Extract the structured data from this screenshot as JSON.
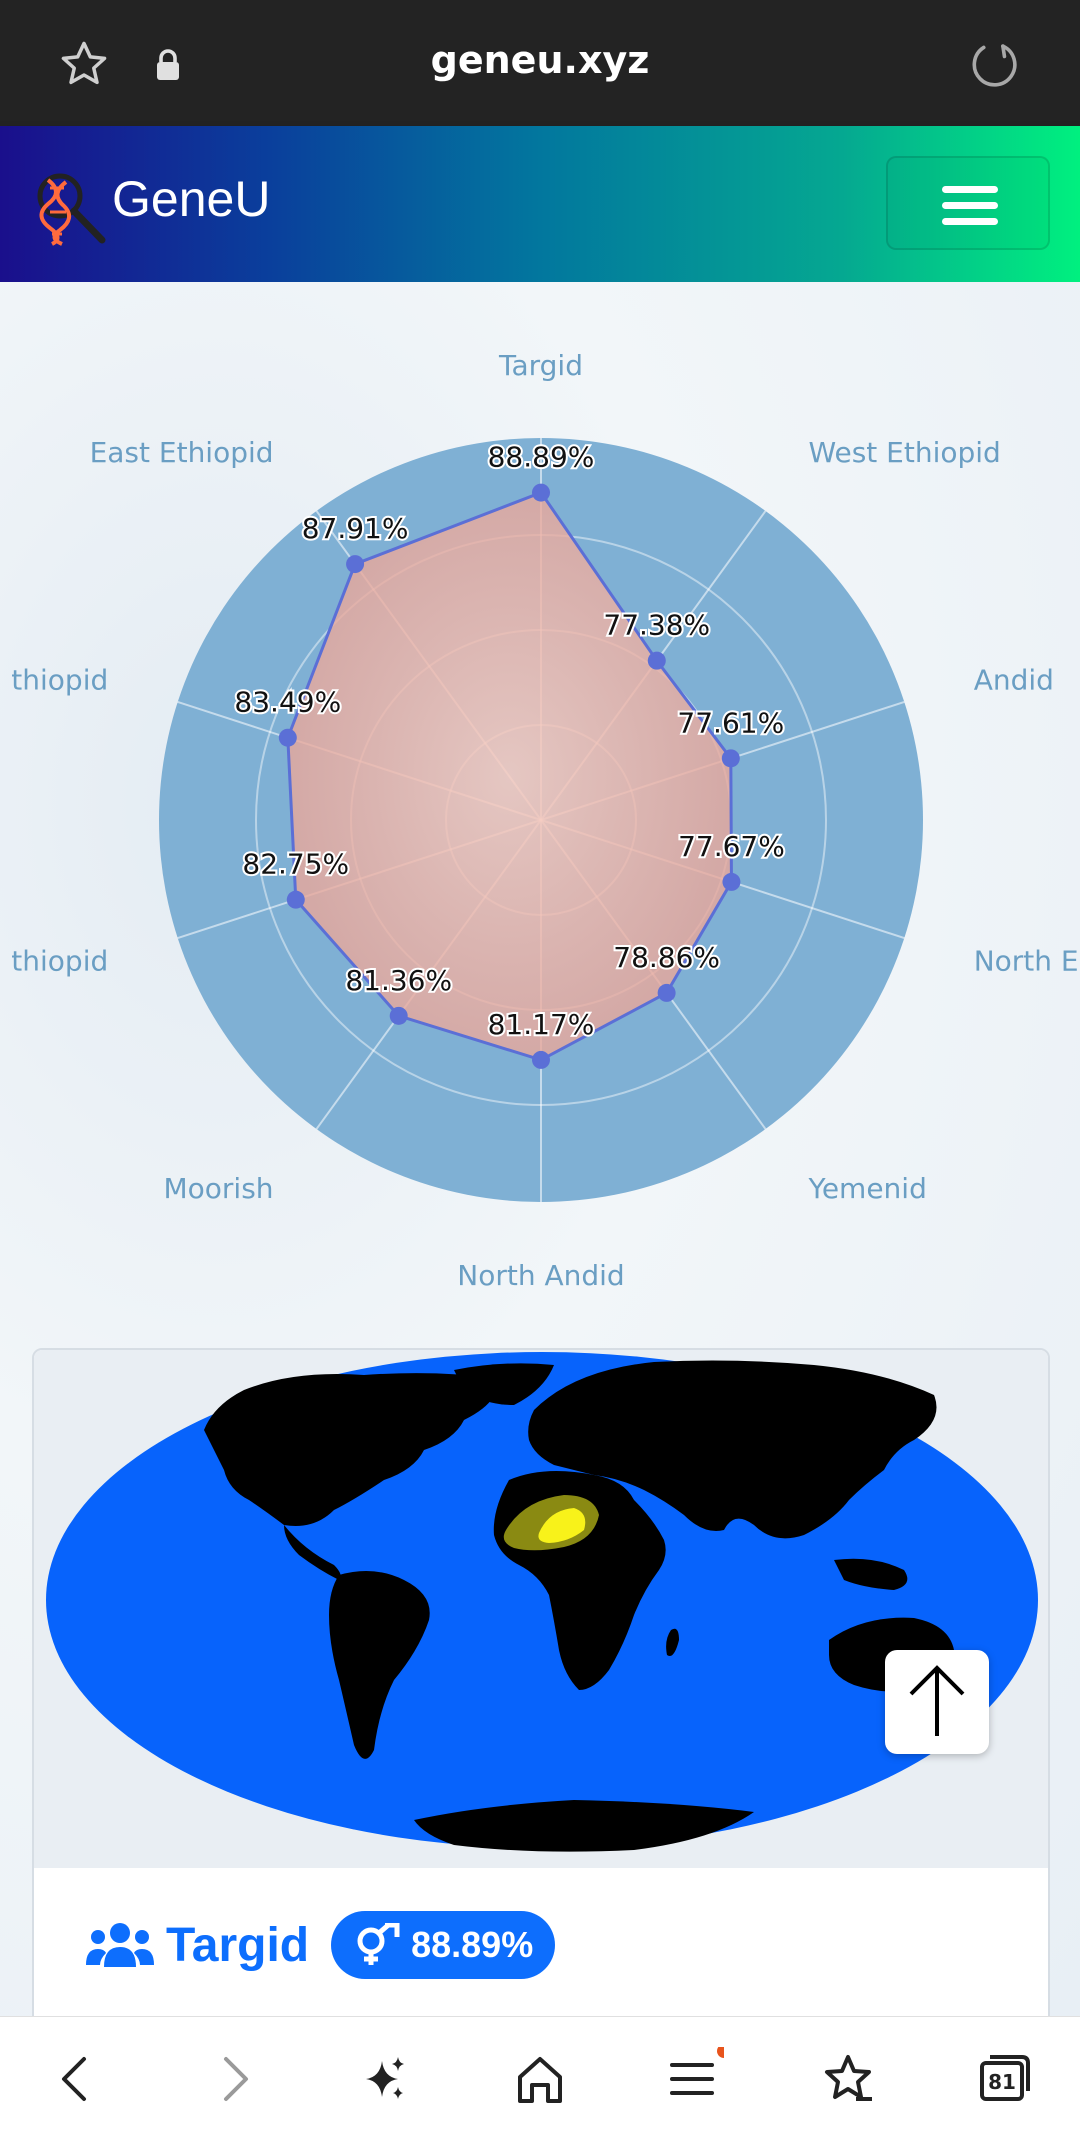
{
  "browser": {
    "url": "geneu.xyz",
    "tab_count": "81"
  },
  "header": {
    "brand": "GeneU"
  },
  "radar": {
    "categories": [
      "Targid",
      "West Ethiopid",
      "Andid",
      "North E",
      "Yemenid",
      "North Andid",
      "Moorish",
      "thiopid",
      "thiopid",
      "East Ethiopid"
    ],
    "values": [
      "88.89%",
      "77.38%",
      "77.61%",
      "77.67%",
      "78.86%",
      "81.17%",
      "81.36%",
      "82.75%",
      "83.49%",
      "87.91%"
    ]
  },
  "chart_data": {
    "type": "radar",
    "categories": [
      "Targid",
      "West Ethiopid",
      "Andid",
      "North E",
      "Yemenid",
      "North Andid",
      "Moorish",
      "thiopid",
      "thiopid",
      "East Ethiopid"
    ],
    "values": [
      88.89,
      77.38,
      77.61,
      77.67,
      78.86,
      81.17,
      81.36,
      82.75,
      83.49,
      87.91
    ],
    "unit": "%",
    "colors": {
      "fill": "#f2b6a8",
      "line": "#5b6fd6",
      "background": "#7fb0d4",
      "label": "#6a9ec3"
    }
  },
  "result": {
    "title": "Targid",
    "percent": "88.89%"
  },
  "colors": {
    "accent": "#0d6efd",
    "ocean": "#0763fc",
    "land": "#000000",
    "highlight": "#f8f21a"
  }
}
